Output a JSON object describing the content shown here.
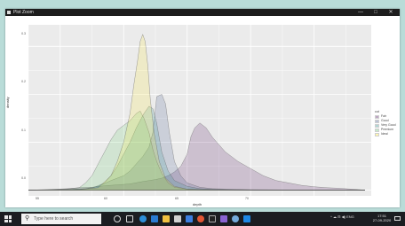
{
  "window": {
    "title": "Plot Zoom",
    "minimize_glyph": "—",
    "maximize_glyph": "□",
    "close_glyph": "✕"
  },
  "chart_data": {
    "type": "area",
    "title": "",
    "xlabel": "depth",
    "ylabel": "density",
    "x_ticks": [
      "55",
      "60",
      "65",
      "70"
    ],
    "y_ticks": [
      "0.0",
      "0.1",
      "0.2",
      "0.3"
    ],
    "xlim": [
      52.5,
      79.5
    ],
    "ylim": [
      -0.012,
      0.345
    ],
    "grid": true,
    "legend_title": "cut",
    "legend_position": "right",
    "series": [
      {
        "name": "Fair",
        "color": "#440154",
        "x": [
          52.5,
          54,
          55.5,
          56.5,
          57.5,
          58.5,
          59.5,
          60.5,
          61.5,
          62,
          62.5,
          63,
          63.5,
          64,
          64.5,
          65,
          65.3,
          65.6,
          66,
          66.5,
          67,
          68,
          69,
          70,
          71,
          72,
          73,
          74,
          75,
          76,
          77,
          78,
          79
        ],
        "y": [
          0,
          0.001,
          0.003,
          0.005,
          0.006,
          0.009,
          0.011,
          0.013,
          0.018,
          0.02,
          0.022,
          0.025,
          0.03,
          0.038,
          0.05,
          0.075,
          0.112,
          0.13,
          0.14,
          0.13,
          0.11,
          0.08,
          0.06,
          0.045,
          0.03,
          0.02,
          0.015,
          0.01,
          0.007,
          0.005,
          0.004,
          0.002,
          0
        ]
      },
      {
        "name": "Good",
        "color": "#3B528B",
        "x": [
          52.5,
          55,
          57,
          58,
          59,
          60,
          60.5,
          61,
          61.5,
          62,
          62.3,
          62.6,
          63,
          63.3,
          63.6,
          64,
          64.5,
          65,
          66,
          67,
          70,
          75,
          79
        ],
        "y": [
          0,
          0.001,
          0.003,
          0.008,
          0.02,
          0.03,
          0.04,
          0.055,
          0.07,
          0.09,
          0.12,
          0.195,
          0.2,
          0.18,
          0.12,
          0.06,
          0.03,
          0.015,
          0.006,
          0.003,
          0.001,
          0,
          0
        ]
      },
      {
        "name": "Very Good",
        "color": "#21908C",
        "x": [
          52.5,
          56,
          57.5,
          58.5,
          59,
          59.5,
          60,
          60.5,
          61,
          61.3,
          61.6,
          62,
          62.3,
          62.6,
          63,
          63.5,
          64,
          65,
          66,
          68,
          71,
          74,
          79
        ],
        "y": [
          0,
          0.001,
          0.004,
          0.015,
          0.03,
          0.05,
          0.075,
          0.1,
          0.13,
          0.145,
          0.16,
          0.175,
          0.17,
          0.14,
          0.08,
          0.04,
          0.02,
          0.008,
          0.003,
          0.001,
          0,
          0,
          0
        ]
      },
      {
        "name": "Premium",
        "color": "#5DC863",
        "x": [
          52.5,
          55.5,
          56.5,
          57,
          57.5,
          58,
          58.5,
          59,
          59.5,
          60,
          60.5,
          61,
          61.3,
          61.6,
          62,
          62.3,
          62.6,
          63,
          63.5,
          64,
          65,
          67,
          70,
          79
        ],
        "y": [
          0,
          0.002,
          0.005,
          0.015,
          0.03,
          0.055,
          0.08,
          0.105,
          0.125,
          0.135,
          0.145,
          0.16,
          0.165,
          0.15,
          0.12,
          0.085,
          0.06,
          0.035,
          0.015,
          0.006,
          0.002,
          0.001,
          0,
          0
        ]
      },
      {
        "name": "Ideal",
        "color": "#FDE725",
        "x": [
          52.5,
          56.5,
          58,
          59,
          59.5,
          60,
          60.5,
          60.8,
          61.1,
          61.3,
          61.5,
          61.7,
          61.9,
          62.1,
          62.4,
          62.8,
          63.3,
          64,
          65,
          66,
          70,
          79
        ],
        "y": [
          0,
          0.001,
          0.005,
          0.03,
          0.06,
          0.1,
          0.16,
          0.22,
          0.27,
          0.31,
          0.325,
          0.31,
          0.26,
          0.19,
          0.12,
          0.06,
          0.025,
          0.008,
          0.002,
          0.001,
          0,
          0
        ]
      }
    ]
  },
  "taskbar": {
    "search_placeholder": "Type here to search",
    "search_glyph": "⚲",
    "tray_icons": "^  ☁  ⊟  ◀)  ENG",
    "time": "17:51",
    "date": "27-09-2020"
  }
}
